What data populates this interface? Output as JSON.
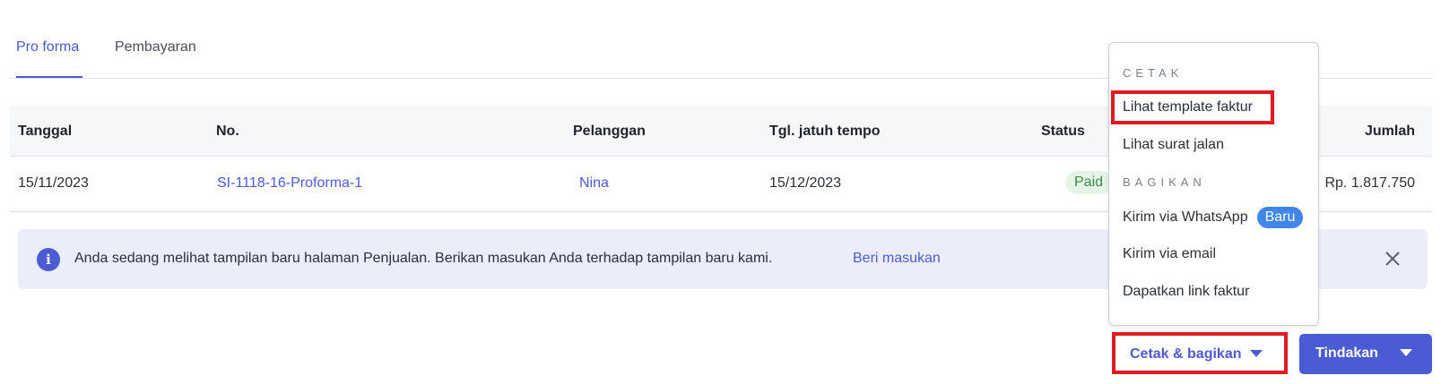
{
  "tabs": [
    {
      "label": "Pro forma",
      "active": true
    },
    {
      "label": "Pembayaran",
      "active": false
    }
  ],
  "table": {
    "headers": [
      "Tanggal",
      "No.",
      "Pelanggan",
      "Tgl. jatuh tempo",
      "Status",
      "Jumlah"
    ],
    "rows": [
      {
        "date": "15/11/2023",
        "number": "SI-1118-16-Proforma-1",
        "customer": "Nina",
        "due_date": "15/12/2023",
        "status": "Paid",
        "amount": "Rp. 1.817.750"
      }
    ]
  },
  "banner": {
    "text": "Anda sedang melihat tampilan baru halaman Penjualan. Berikan masukan Anda terhadap tampilan baru kami.",
    "link": "Beri masukan",
    "icon": "info-icon"
  },
  "menu": {
    "print_section": "CETAK",
    "print_items": [
      "Lihat template faktur",
      "Lihat surat jalan"
    ],
    "share_section": "BAGIKAN",
    "whatsapp": "Kirim via WhatsApp",
    "whatsapp_badge": "Baru",
    "email": "Kirim via email",
    "link": "Dapatkan link faktur"
  },
  "buttons": {
    "print_share": "Cetak & bagikan",
    "action": "Tindakan"
  },
  "colors": {
    "accent": "#4a5bd4",
    "highlight": "#e01b24",
    "paid_bg": "#e6f4e8",
    "paid_text": "#3b8a47",
    "banner_bg": "#ebedfb",
    "new_badge": "#3f86e8"
  }
}
